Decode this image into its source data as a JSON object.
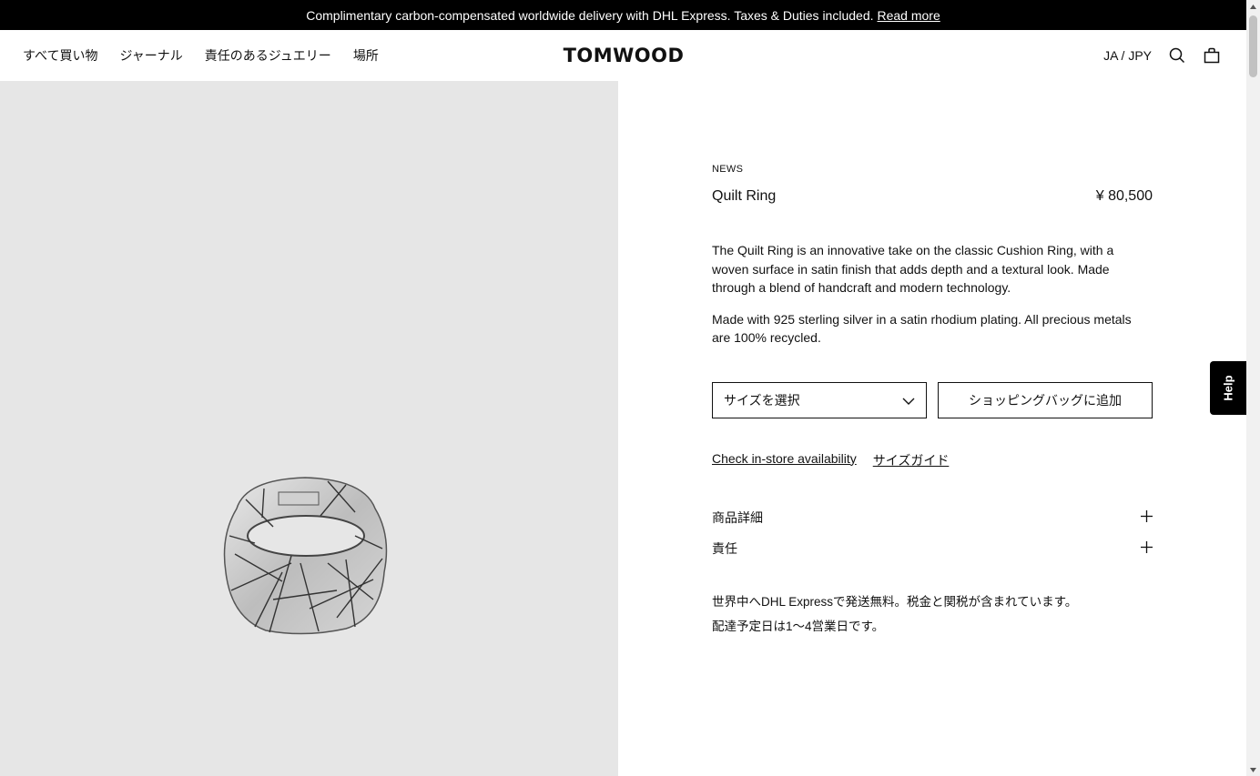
{
  "announcement": {
    "text": "Complimentary carbon-compensated worldwide delivery with DHL Express. Taxes & Duties included.",
    "link": "Read more"
  },
  "nav": {
    "items": [
      {
        "label": "すべて買い物"
      },
      {
        "label": "ジャーナル"
      },
      {
        "label": "責任のあるジュエリー"
      },
      {
        "label": "場所"
      }
    ]
  },
  "brand": {
    "logo": "TOMWOOD"
  },
  "header_right": {
    "locale": "JA / JPY",
    "search_icon": "search-icon",
    "bag_icon": "shopping-bag-icon"
  },
  "product": {
    "collection": "NEWS",
    "name": "Quilt Ring",
    "price": "¥ 80,500",
    "description": [
      "The Quilt Ring is an innovative take on the classic Cushion Ring, with a woven surface in satin finish that adds depth and a textural look. Made through a blend of handcraft and modern technology.",
      "Made with 925 sterling silver in a satin rhodium plating. All precious metals are 100% recycled."
    ],
    "size_select": "サイズを選択",
    "add_to_bag": "ショッピングバッグに追加",
    "links": {
      "store": "Check in-store availability",
      "size_guide": "サイズガイド"
    },
    "accordion": [
      {
        "label": "商品詳細"
      },
      {
        "label": "責任"
      }
    ],
    "delivery": [
      "世界中へDHL Expressで発送無料。税金と関税が含まれています。",
      "配達予定日は1〜4営業日です。"
    ]
  },
  "help": {
    "label": "Help"
  },
  "colors": {
    "accent": "#000000",
    "image_bg": "#e6e6e6"
  }
}
